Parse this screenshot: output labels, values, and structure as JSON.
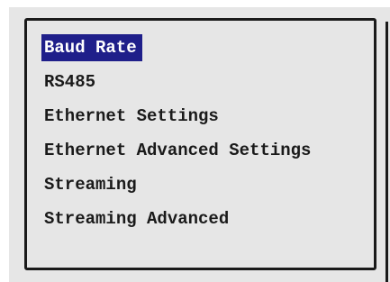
{
  "menu": {
    "items": [
      {
        "label": "Baud Rate",
        "selected": true
      },
      {
        "label": "RS485",
        "selected": false
      },
      {
        "label": "Ethernet Settings",
        "selected": false
      },
      {
        "label": "Ethernet Advanced Settings",
        "selected": false
      },
      {
        "label": "Streaming",
        "selected": false
      },
      {
        "label": "Streaming Advanced",
        "selected": false
      }
    ]
  },
  "colors": {
    "selection_background": "#1f1f8a",
    "selection_text": "#ffffff",
    "panel_background": "#e6e6e6",
    "text": "#1a1a1a"
  }
}
